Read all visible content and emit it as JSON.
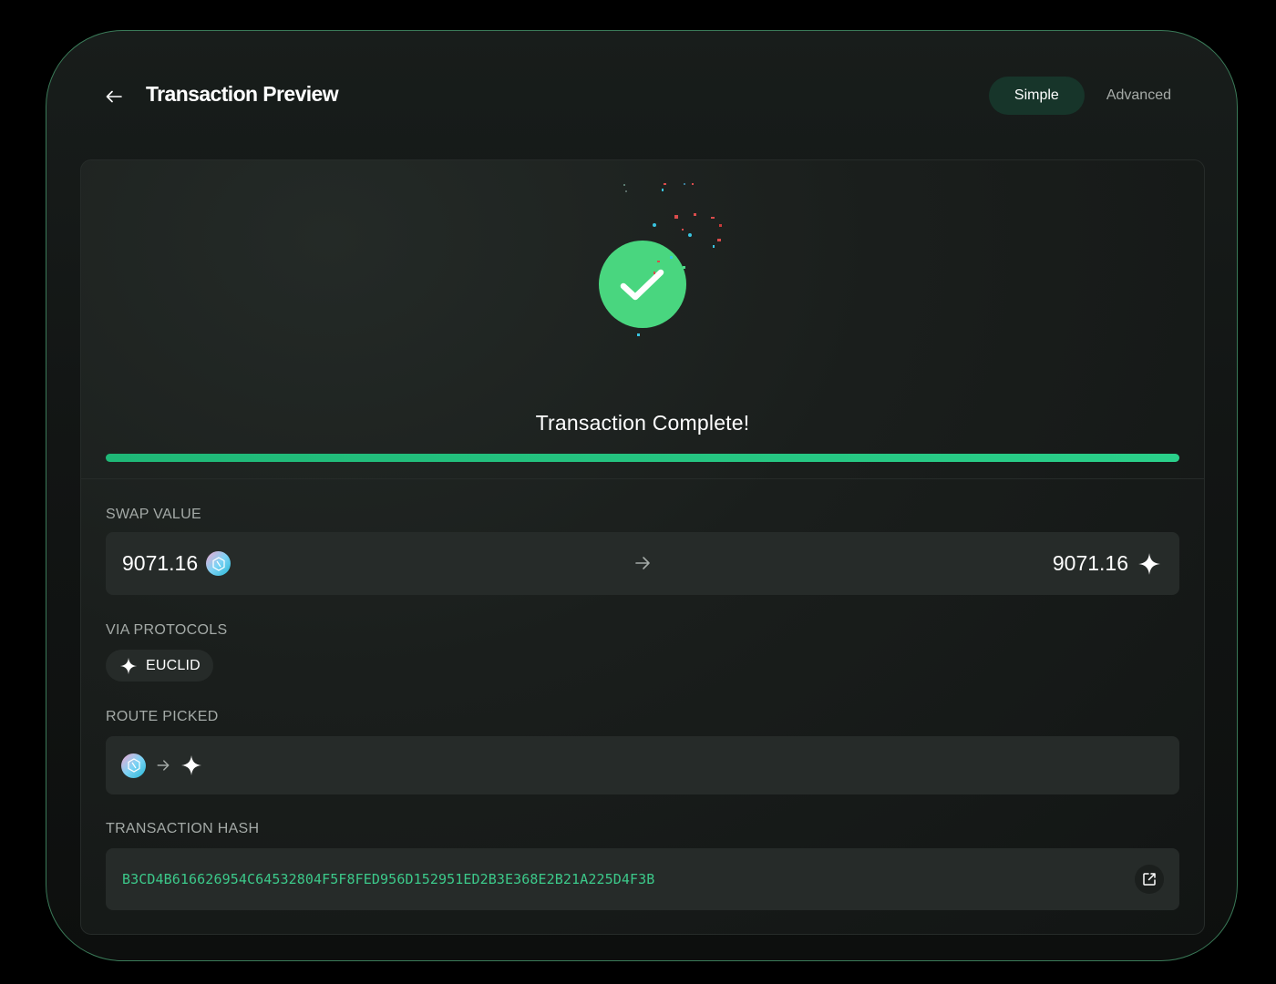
{
  "header": {
    "title": "Transaction Preview",
    "back_icon": "arrow-left-icon",
    "modes": [
      {
        "label": "Simple",
        "active": true
      },
      {
        "label": "Advanced",
        "active": false
      }
    ]
  },
  "status": {
    "message": "Transaction Complete!",
    "icon": "check-circle-icon",
    "progress": 1.0,
    "success_color": "#49d67f",
    "progress_color": "#1fb877"
  },
  "swap": {
    "label": "SWAP VALUE",
    "from_amount": "9071.16",
    "from_token_icon": "token-logo-icon",
    "arrow_icon": "arrow-right-icon",
    "to_amount": "9071.16",
    "to_token_icon": "sparkle-icon"
  },
  "protocols": {
    "label": "VIA PROTOCOLS",
    "items": [
      {
        "name": "EUCLID",
        "icon": "sparkle-icon"
      }
    ]
  },
  "route": {
    "label": "ROUTE PICKED",
    "steps": [
      "token-logo-icon",
      "arrow-right-icon",
      "sparkle-icon"
    ]
  },
  "hash": {
    "label": "TRANSACTION HASH",
    "value": "B3CD4B616626954C64532804F5F8FED956D152951ED2B3E368E2B21A225D4F3B",
    "link_icon": "external-link-icon",
    "color": "#3cc98a"
  },
  "theme": {
    "frame_border": "#3a7a58",
    "accent": "#17352a"
  }
}
